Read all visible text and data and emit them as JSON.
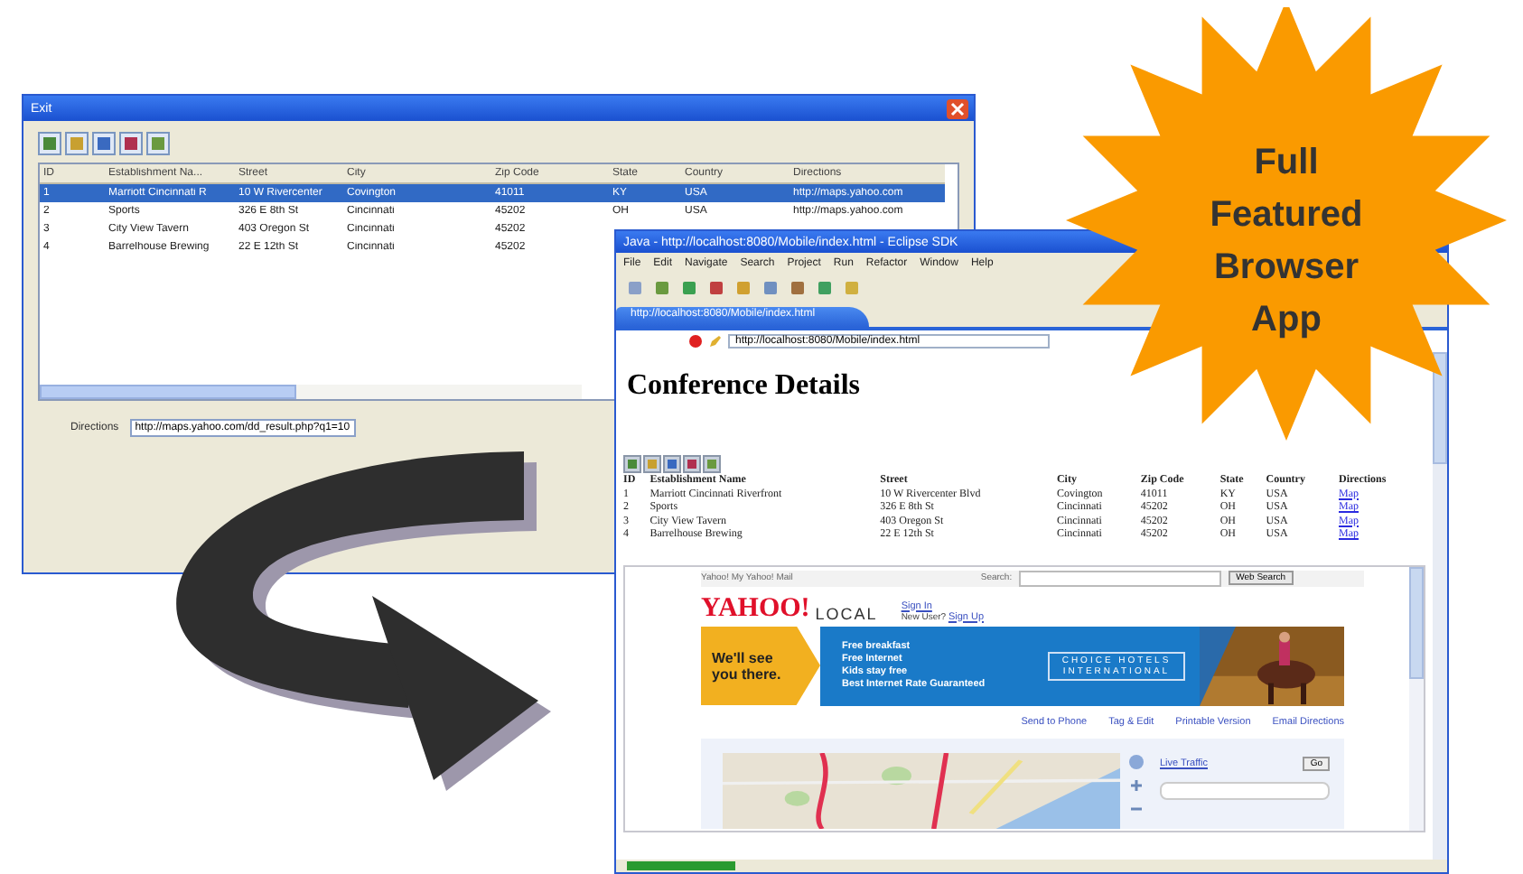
{
  "grid_window": {
    "title": "Exit",
    "columns": [
      "ID",
      "Establishment Na...",
      "Street",
      "City",
      "Zip Code",
      "State",
      "Country",
      "Directions"
    ],
    "rows": [
      {
        "selected": true,
        "cells": [
          "1",
          "Marriott Cincinnati R",
          "10 W Rivercenter",
          "Covington",
          "41011",
          "KY",
          "USA",
          "http://maps.yahoo.com"
        ]
      },
      {
        "selected": false,
        "cells": [
          "2",
          "Sports",
          "326 E 8th St",
          "Cincinnati",
          "45202",
          "OH",
          "USA",
          "http://maps.yahoo.com"
        ]
      },
      {
        "selected": false,
        "cells": [
          "3",
          "City View Tavern",
          "403 Oregon St",
          "Cincinnati",
          "45202"
        ]
      },
      {
        "selected": false,
        "cells": [
          "4",
          "Barrelhouse Brewing",
          "22 E 12th St",
          "Cincinnati",
          "45202"
        ]
      }
    ],
    "directions": {
      "label": "Directions",
      "value": "http://maps.yahoo.com/dd_result.php?q1=10"
    }
  },
  "browser_window": {
    "title": "Java - http://localhost:8080/Mobile/index.html - Eclipse SDK",
    "menu": [
      "File",
      "Edit",
      "Navigate",
      "Search",
      "Project",
      "Run",
      "Refactor",
      "Window",
      "Help"
    ],
    "tab": "http://localhost:8080/Mobile/index.html",
    "address": "http://localhost:8080/Mobile/index.html",
    "heading": "Conference Details",
    "columns": [
      "ID",
      "Establishment Name",
      "Street",
      "City",
      "Zip Code",
      "State",
      "Country",
      "Directions"
    ],
    "rows": [
      {
        "cells": [
          "1",
          "Marriott Cincinnati Riverfront",
          "10 W Rivercenter Blvd",
          "Covington",
          "41011",
          "KY",
          "USA"
        ],
        "link": "Map"
      },
      {
        "cells": [
          "2",
          "Sports",
          "326 E 8th St",
          "Cincinnati",
          "45202",
          "OH",
          "USA"
        ],
        "link": "Map"
      },
      {
        "cells": [
          "3",
          "City View Tavern",
          "403 Oregon St",
          "Cincinnati",
          "45202",
          "OH",
          "USA"
        ],
        "link": "Map"
      },
      {
        "cells": [
          "4",
          "Barrelhouse Brewing",
          "22 E 12th St",
          "Cincinnati",
          "45202",
          "OH",
          "USA"
        ],
        "link": "Map"
      }
    ],
    "yahoo": {
      "top_links": "Yahoo! My Yahoo! Mail",
      "search_label": "Search:",
      "search_button": "Web Search",
      "logo": "YAHOO!",
      "logo_sub": "LOCAL",
      "sign_in": "Sign In",
      "sign_up_prompt": "New User?",
      "sign_up": "Sign Up",
      "banner": {
        "headline": "We'll see you there.",
        "bullets": [
          "Free breakfast",
          "Free Internet",
          "Kids stay free",
          "Best Internet Rate Guaranteed"
        ],
        "brand": "CHOICE HOTELS INTERNATIONAL"
      },
      "actions": [
        "Send to Phone",
        "Tag & Edit",
        "Printable Version",
        "Email Directions"
      ],
      "traffic": "Live Traffic",
      "go": "Go"
    }
  },
  "starburst": {
    "text": "Full Featured Browser App"
  }
}
